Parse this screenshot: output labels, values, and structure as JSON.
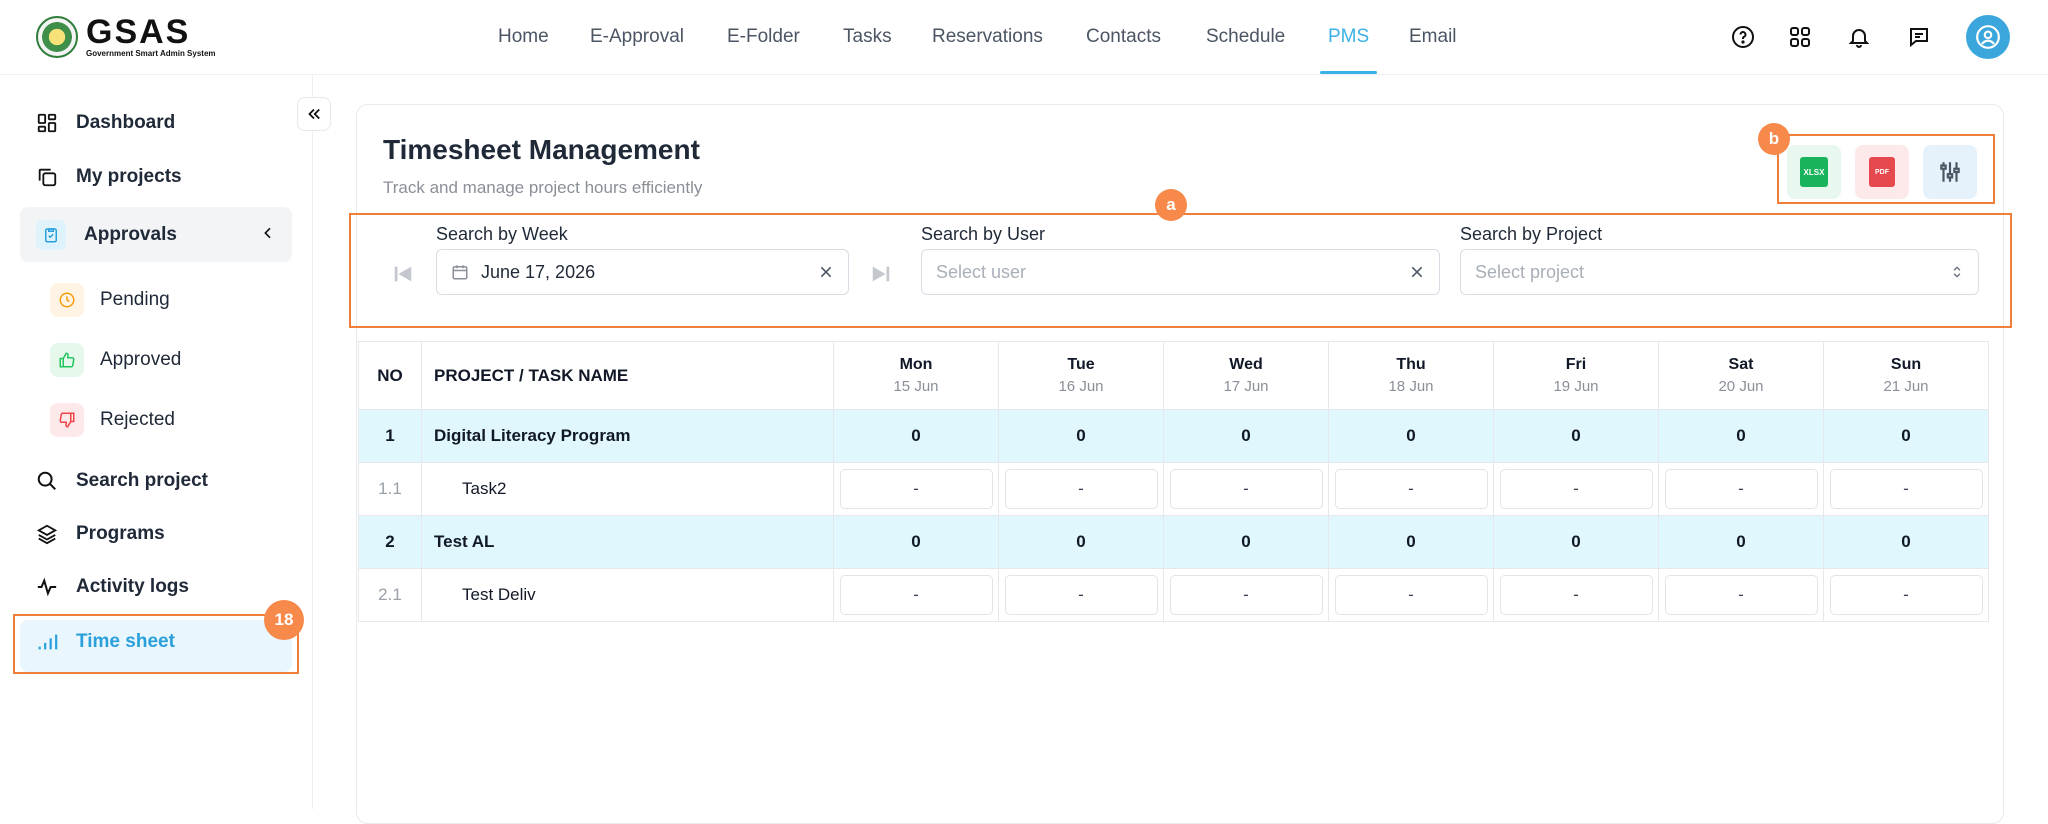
{
  "app": {
    "logo_title": "GSAS",
    "logo_subtitle": "Government Smart Admin System"
  },
  "nav": {
    "items": [
      "Home",
      "E-Approval",
      "E-Folder",
      "Tasks",
      "Reservations",
      "Contacts",
      "Schedule",
      "PMS",
      "Email"
    ],
    "active": "PMS"
  },
  "sidebar": {
    "dashboard": "Dashboard",
    "my_projects": "My projects",
    "approvals": "Approvals",
    "pending": "Pending",
    "approved": "Approved",
    "rejected": "Rejected",
    "search_project": "Search project",
    "programs": "Programs",
    "activity_logs": "Activity logs",
    "time_sheet": "Time sheet"
  },
  "annotations": {
    "a": "a",
    "b": "b",
    "sidebar_badge": "18"
  },
  "page": {
    "title": "Timesheet Management",
    "subtitle": "Track and manage project hours efficiently"
  },
  "export": {
    "xlsx": "XLSX",
    "pdf": "PDF"
  },
  "filters": {
    "week_label": "Search by Week",
    "week_value": "June 17, 2026",
    "user_label": "Search by User",
    "user_placeholder": "Select user",
    "project_label": "Search by Project",
    "project_placeholder": "Select project"
  },
  "table": {
    "col_no": "NO",
    "col_name": "PROJECT / TASK NAME",
    "days": [
      {
        "name": "Mon",
        "date": "15 Jun"
      },
      {
        "name": "Tue",
        "date": "16 Jun"
      },
      {
        "name": "Wed",
        "date": "17 Jun"
      },
      {
        "name": "Thu",
        "date": "18 Jun"
      },
      {
        "name": "Fri",
        "date": "19 Jun"
      },
      {
        "name": "Sat",
        "date": "20 Jun"
      },
      {
        "name": "Sun",
        "date": "21 Jun"
      }
    ],
    "rows": [
      {
        "no": "1",
        "name": "Digital Literacy Program",
        "kind": "project",
        "values": [
          "0",
          "0",
          "0",
          "0",
          "0",
          "0",
          "0"
        ]
      },
      {
        "no": "1.1",
        "name": "Task2",
        "kind": "task",
        "values": [
          "-",
          "-",
          "-",
          "-",
          "-",
          "-",
          "-"
        ]
      },
      {
        "no": "2",
        "name": "Test AL",
        "kind": "project",
        "values": [
          "0",
          "0",
          "0",
          "0",
          "0",
          "0",
          "0"
        ]
      },
      {
        "no": "2.1",
        "name": "Test Deliv",
        "kind": "task",
        "values": [
          "-",
          "-",
          "-",
          "-",
          "-",
          "-",
          "-"
        ]
      }
    ]
  },
  "colors": {
    "accent": "#3ab2e6",
    "highlight": "#f07f3c",
    "project_row": "#e0f7fd"
  }
}
